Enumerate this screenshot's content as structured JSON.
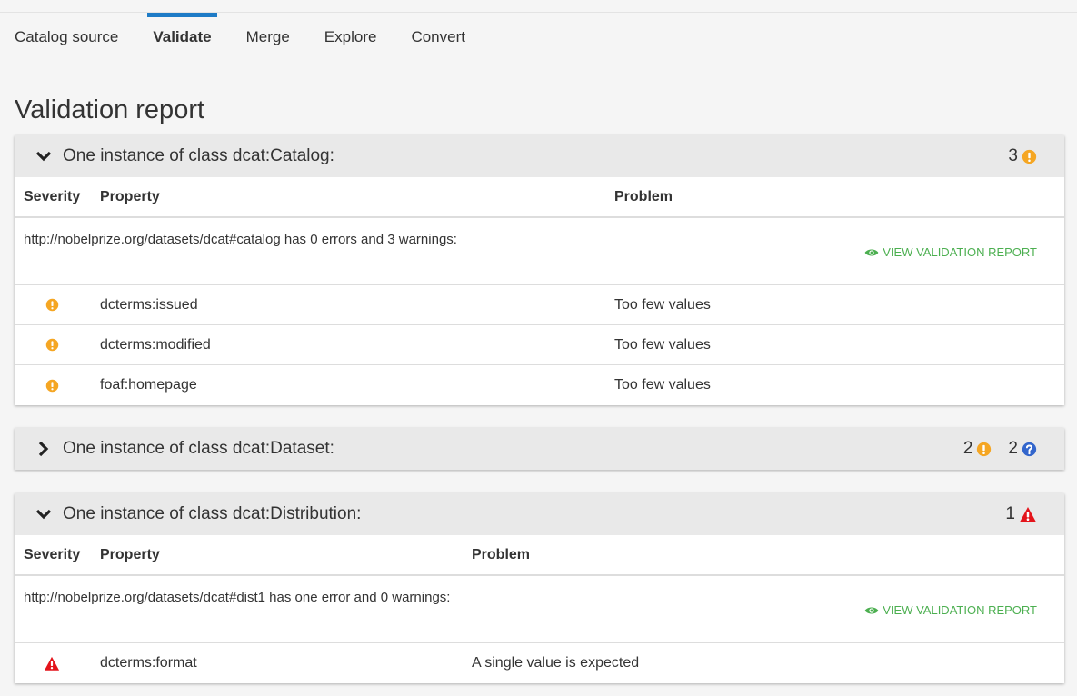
{
  "tabs": [
    {
      "label": "Catalog source",
      "active": false
    },
    {
      "label": "Validate",
      "active": true
    },
    {
      "label": "Merge",
      "active": false
    },
    {
      "label": "Explore",
      "active": false
    },
    {
      "label": "Convert",
      "active": false
    }
  ],
  "page_title": "Validation report",
  "colors": {
    "accent": "#1e7bc6",
    "warning": "#f5a623",
    "error": "#e4141b",
    "info": "#3366cc",
    "link": "#4caf50"
  },
  "panels": {
    "catalog": {
      "title": "One instance of class dcat:Catalog:",
      "expanded": true,
      "counts": [
        {
          "value": "3",
          "icon": "warning-icon"
        }
      ],
      "headers": {
        "severity": "Severity",
        "property": "Property",
        "problem": "Problem"
      },
      "summary": "http://nobelprize.org/datasets/dcat#catalog has 0 errors and 3 warnings:",
      "view_link": "VIEW VALIDATION REPORT",
      "rows": [
        {
          "severity": "warning",
          "property": "dcterms:issued",
          "problem": "Too few values"
        },
        {
          "severity": "warning",
          "property": "dcterms:modified",
          "problem": "Too few values"
        },
        {
          "severity": "warning",
          "property": "foaf:homepage",
          "problem": "Too few values"
        }
      ]
    },
    "dataset": {
      "title": "One instance of class dcat:Dataset:",
      "expanded": false,
      "counts": [
        {
          "value": "2",
          "icon": "warning-icon"
        },
        {
          "value": "2",
          "icon": "question-icon"
        }
      ]
    },
    "distribution": {
      "title": "One instance of class dcat:Distribution:",
      "expanded": true,
      "counts": [
        {
          "value": "1",
          "icon": "error-icon"
        }
      ],
      "headers": {
        "severity": "Severity",
        "property": "Property",
        "problem": "Problem"
      },
      "summary": "http://nobelprize.org/datasets/dcat#dist1 has one error and 0 warnings:",
      "view_link": "VIEW VALIDATION REPORT",
      "rows": [
        {
          "severity": "error",
          "property": "dcterms:format",
          "problem": "A single value is expected"
        }
      ]
    }
  }
}
